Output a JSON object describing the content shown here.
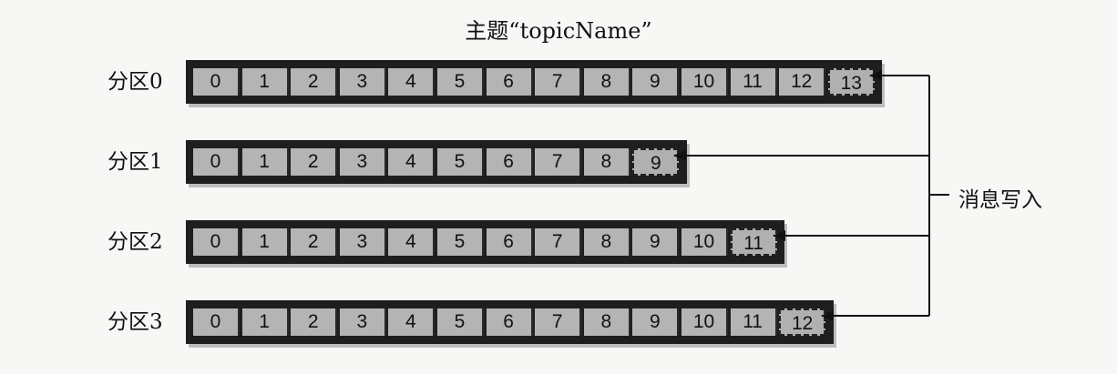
{
  "title": "主题“topicName”",
  "write_label": "消息写入",
  "partitions": [
    {
      "label": "分区0",
      "offsets": [
        "0",
        "1",
        "2",
        "3",
        "4",
        "5",
        "6",
        "7",
        "8",
        "9",
        "10",
        "11",
        "12"
      ],
      "next_offset": "13"
    },
    {
      "label": "分区1",
      "offsets": [
        "0",
        "1",
        "2",
        "3",
        "4",
        "5",
        "6",
        "7",
        "8"
      ],
      "next_offset": "9"
    },
    {
      "label": "分区2",
      "offsets": [
        "0",
        "1",
        "2",
        "3",
        "4",
        "5",
        "6",
        "7",
        "8",
        "9",
        "10"
      ],
      "next_offset": "11"
    },
    {
      "label": "分区3",
      "offsets": [
        "0",
        "1",
        "2",
        "3",
        "4",
        "5",
        "6",
        "7",
        "8",
        "9",
        "10",
        "11"
      ],
      "next_offset": "12"
    }
  ]
}
